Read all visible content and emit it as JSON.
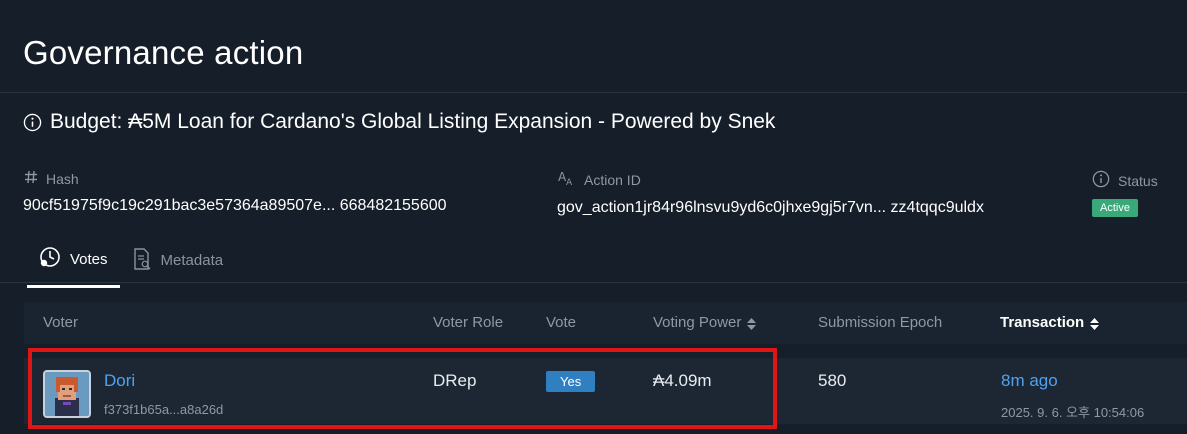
{
  "page": {
    "title": "Governance action"
  },
  "action": {
    "title": "Budget: ₳5M Loan for Cardano's Global Listing Expansion - Powered by Snek"
  },
  "fields": {
    "hash": {
      "label": "Hash",
      "value": "90cf51975f9c19c291bac3e57364a89507e... 668482155600",
      "icon": "hash-icon"
    },
    "action_id": {
      "label": "Action ID",
      "value": "gov_action1jr84r96lnsvu9yd6c0jhxe9gj5r7vn...  zz4tqqc9uldx",
      "icon": "text-size-icon"
    },
    "status": {
      "label": "Status",
      "value": "Active",
      "icon": "info-icon",
      "color": "#3aa97a"
    }
  },
  "tabs": [
    {
      "label": "Votes",
      "icon": "votes-icon",
      "active": true
    },
    {
      "label": "Metadata",
      "icon": "document-icon",
      "active": false
    }
  ],
  "table": {
    "headers": {
      "voter": "Voter",
      "voter_role": "Voter Role",
      "vote": "Vote",
      "voting_power": "Voting Power",
      "submission_epoch": "Submission Epoch",
      "transaction": "Transaction"
    },
    "rows": [
      {
        "voter_name": "Dori",
        "voter_id": "f373f1b65a...a8a26d",
        "voter_role": "DRep",
        "vote": "Yes",
        "voting_power": "₳4.09m",
        "submission_epoch": "580",
        "tx_time": "8m ago",
        "tx_date": "2025. 9. 6. 오후 10:54:06"
      }
    ]
  },
  "colors": {
    "background": "#151e29",
    "accent_link": "#4ea3f0",
    "vote_yes": "#2f7fc1",
    "highlight": "#e01515"
  }
}
